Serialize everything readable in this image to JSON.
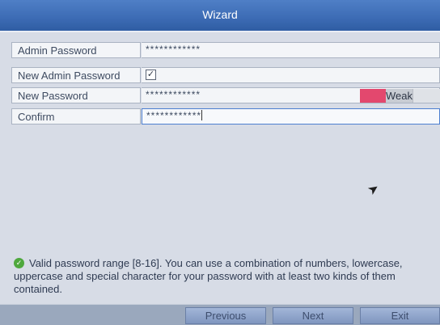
{
  "window": {
    "title": "Wizard"
  },
  "rows": {
    "admin_password": {
      "label": "Admin Password",
      "value": "************"
    },
    "new_admin_password": {
      "label": "New Admin Password",
      "checked": true,
      "check_glyph": "✓"
    },
    "new_password": {
      "label": "New Password",
      "value": "************"
    },
    "confirm": {
      "label": "Confirm",
      "value": "************"
    }
  },
  "strength": {
    "label": "Weak",
    "level_fraction": 0.33,
    "colors": {
      "weak": "#e3486e"
    }
  },
  "hint": {
    "icon": "check-circle-icon",
    "text": "Valid password range [8-16]. You can use a combination of numbers, lowercase, uppercase and special character for your password with at least two kinds of them contained."
  },
  "buttons": {
    "previous": "Previous",
    "next": "Next",
    "exit": "Exit"
  },
  "icons": {
    "mouse_cursor": "mouse-cursor-icon"
  }
}
